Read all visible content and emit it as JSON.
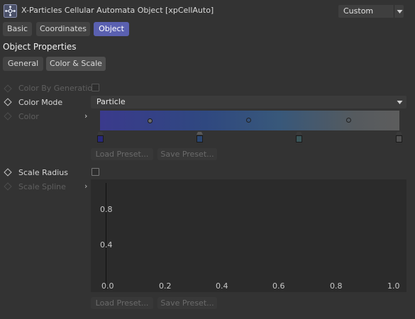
{
  "window": {
    "title": "X-Particles Cellular Automata Object [xpCellAuto]",
    "preset_value": "Custom"
  },
  "tabs": [
    {
      "label": "Basic",
      "active": false
    },
    {
      "label": "Coordinates",
      "active": false
    },
    {
      "label": "Object",
      "active": true
    }
  ],
  "section_title": "Object Properties",
  "subtabs": [
    {
      "label": "General",
      "active": false
    },
    {
      "label": "Color & Scale",
      "active": true
    }
  ],
  "params": {
    "color_by_generation": {
      "label": "Color By Generation",
      "checked": false,
      "enabled": false
    },
    "color_mode": {
      "label": "Color Mode",
      "value": "Particle",
      "enabled": true
    },
    "color": {
      "label": "Color",
      "enabled": false
    },
    "scale_radius": {
      "label": "Scale Radius",
      "checked": false,
      "enabled": true
    },
    "scale_spline": {
      "label": "Scale Spline",
      "enabled": false
    }
  },
  "gradient": {
    "colors": [
      "#3a3a8c",
      "#2f4880",
      "#38587a",
      "#555a5e",
      "#5d5d5d"
    ]
  },
  "buttons": {
    "load_preset": "Load Preset...",
    "save_preset": "Save Preset..."
  },
  "spline": {
    "y_ticks": [
      "0.8",
      "0.4"
    ],
    "x_ticks": [
      "0.0",
      "0.2",
      "0.4",
      "0.6",
      "0.8",
      "1.0"
    ]
  },
  "colors": {
    "accent": "#5a60b0",
    "background": "#333333"
  }
}
